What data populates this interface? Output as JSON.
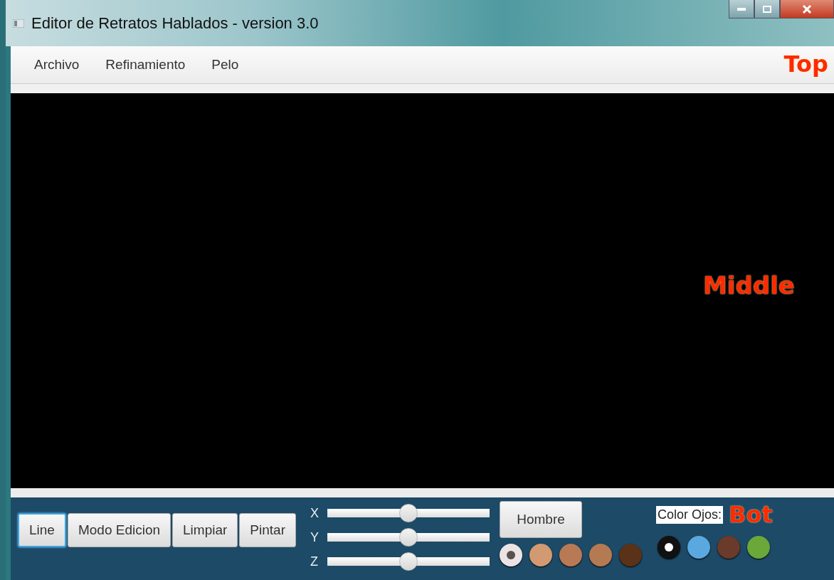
{
  "window": {
    "title": "Editor de Retratos Hablados - version 3.0"
  },
  "menu": [
    "Archivo",
    "Refinamiento",
    "Pelo"
  ],
  "annotations": [
    {
      "label": "Top"
    },
    {
      "label": "Middle"
    },
    {
      "label": "Bot"
    }
  ],
  "buttons": [
    {
      "label": "Line",
      "focused": true
    },
    {
      "label": "Modo Edicion",
      "focused": false
    },
    {
      "label": "Limpiar",
      "focused": false
    },
    {
      "label": "Pintar",
      "focused": false
    }
  ],
  "sliders": [
    {
      "label": "X",
      "level": 0.5
    },
    {
      "label": "Y",
      "level": 0.5
    },
    {
      "label": "Z",
      "level": 0.5
    }
  ],
  "gender_button": "Hombre",
  "skin_colors": [
    {
      "color": "#ece4e4",
      "selected": true
    },
    {
      "color": "#d19a72",
      "selected": false
    },
    {
      "color": "#b87a55",
      "selected": false
    },
    {
      "color": "#b47a52",
      "selected": false
    },
    {
      "color": "#5a3218",
      "selected": false
    }
  ],
  "eye_color_label": "Color Ojos:",
  "eye_colors": [
    {
      "color": "#111111",
      "selected": true
    },
    {
      "color": "#5aa8e0",
      "selected": false
    },
    {
      "color": "#6a3a2a",
      "selected": false
    },
    {
      "color": "#6aa83a",
      "selected": false
    }
  ]
}
